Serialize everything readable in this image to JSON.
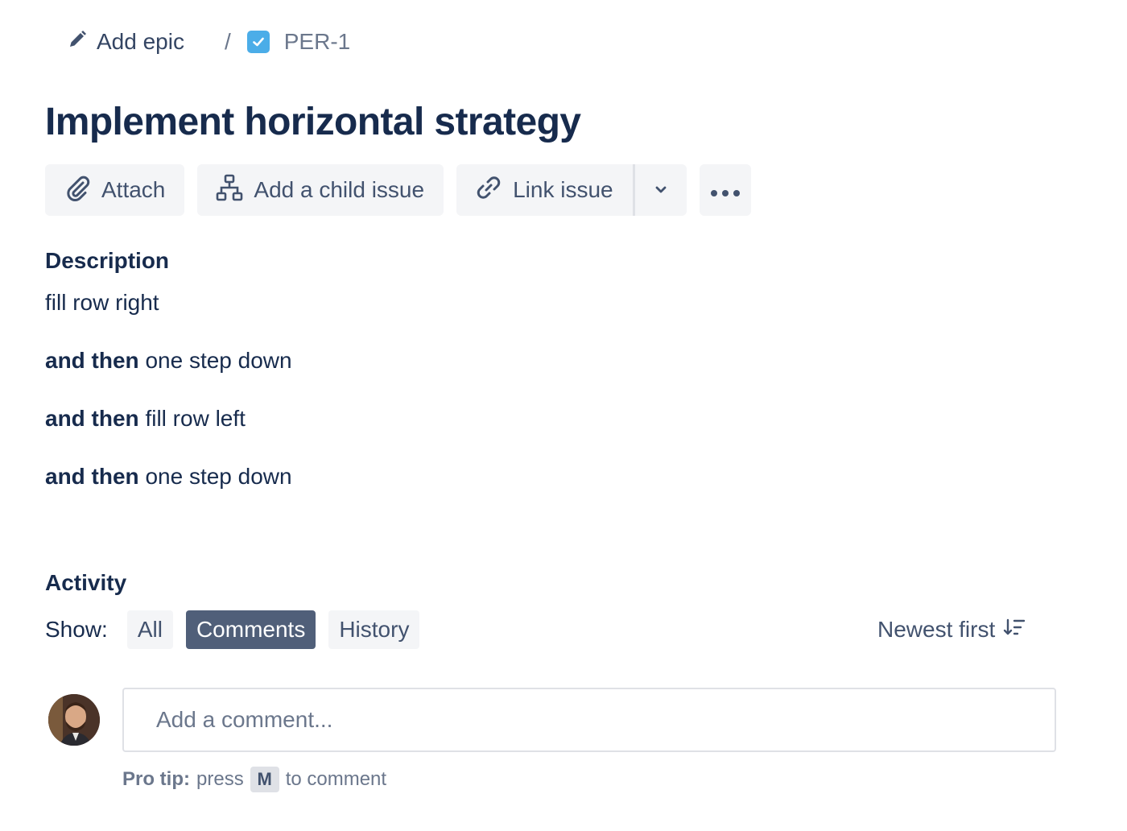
{
  "breadcrumb": {
    "epic_label": "Add epic",
    "separator": "/",
    "issue_key": "PER-1"
  },
  "issue": {
    "title": "Implement horizontal strategy"
  },
  "toolbar": {
    "attach_label": "Attach",
    "child_issue_label": "Add a child issue",
    "link_issue_label": "Link issue"
  },
  "description": {
    "heading": "Description",
    "lines": [
      {
        "bold": "",
        "text": "fill row right"
      },
      {
        "bold": "and then",
        "text": " one step down"
      },
      {
        "bold": "and then",
        "text": " fill row left"
      },
      {
        "bold": "and then",
        "text": " one step down"
      }
    ]
  },
  "activity": {
    "heading": "Activity",
    "show_label": "Show:",
    "filters": [
      {
        "label": "All",
        "active": false
      },
      {
        "label": "Comments",
        "active": true
      },
      {
        "label": "History",
        "active": false
      }
    ],
    "sort_label": "Newest first"
  },
  "comment": {
    "placeholder": "Add a comment...",
    "protip_bold": "Pro tip:",
    "protip_press": "press",
    "protip_key": "M",
    "protip_rest": "to comment"
  },
  "colors": {
    "text_primary": "#172b4d",
    "text_subtle": "#42526e",
    "button_bg": "#f4f5f7",
    "active_filter_bg": "#505f79",
    "task_icon": "#4bade8"
  },
  "icons": [
    "pencil-icon",
    "task-checkbox-icon",
    "paperclip-icon",
    "hierarchy-icon",
    "link-icon",
    "chevron-down-icon",
    "more-icon",
    "sort-icon"
  ]
}
